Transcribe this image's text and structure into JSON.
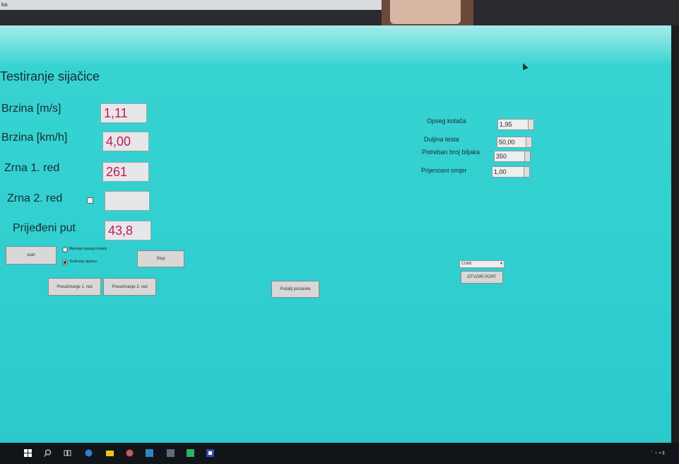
{
  "window": {
    "menu_text": "ka",
    "title": "Testiranje sijačice"
  },
  "fields": {
    "speed_ms": {
      "label": "Brzina [m/s]",
      "value": "1,11"
    },
    "speed_kmh": {
      "label": "Brzina [km/h]",
      "value": "4,00"
    },
    "row1": {
      "label": "Zrna 1. red",
      "value": "261"
    },
    "row2": {
      "label": "Zrna 2. red",
      "value": ""
    },
    "distance": {
      "label": "Prijeđeni put",
      "value": "43,8"
    }
  },
  "controls": {
    "start_label": "start",
    "stop_label": "Stop",
    "radio_measure_label": "Mjerenje opsega kotača",
    "radio_test_label": "Testiranje sijačice",
    "recount_row1_label": "Preuzimanje 1. red",
    "recount_row2_label": "Preuzimanje 2. red",
    "send_params_label": "Pošalji postavke"
  },
  "settings": {
    "wheel_circumference": {
      "label": "Opseg kotača",
      "value": "1,95"
    },
    "test_length": {
      "label": "Duljina testa",
      "value": "50,00"
    },
    "plants_needed": {
      "label": "Potreban broj biljaka",
      "value": "350"
    },
    "gear_ratio": {
      "label": "Prijenosni omjer",
      "value": "1,00"
    }
  },
  "port": {
    "selected": "COM5",
    "open_label": "OTVORI PORT"
  },
  "colors": {
    "background": "#33d0d0",
    "value_text": "#c2185b"
  }
}
